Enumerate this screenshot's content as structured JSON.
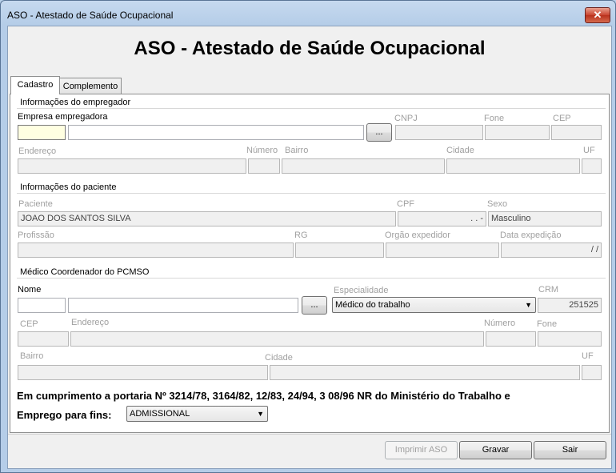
{
  "window": {
    "title": "ASO - Atestado de Saúde Ocupacional",
    "close_symbol": "✕"
  },
  "heading": "ASO - Atestado de Saúde Ocupacional",
  "tabs": [
    {
      "label": "Cadastro"
    },
    {
      "label": "Complemento"
    }
  ],
  "employer": {
    "section_title": "Informações do empregador",
    "company_label": "Empresa empregadora",
    "cnpj_label": "CNPJ",
    "fone_label": "Fone",
    "cep_label": "CEP",
    "address_label": "Endereço",
    "number_label": "Número",
    "district_label": "Bairro",
    "city_label": "Cidade",
    "uf_label": "UF",
    "browse_label": "..."
  },
  "patient": {
    "section_title": "Informações do paciente",
    "name_label": "Paciente",
    "name_value": "JOAO DOS SANTOS SILVA",
    "cpf_label": "CPF",
    "cpf_value": ". . -",
    "sex_label": "Sexo",
    "sex_value": "Masculino",
    "profession_label": "Profissão",
    "rg_label": "RG",
    "issuer_label": "Orgão expedidor",
    "issue_date_label": "Data expedição",
    "issue_date_value": "/ /"
  },
  "doctor": {
    "section_title": "Médico Coordenador do PCMSO",
    "name_label": "Nome",
    "browse_label": "...",
    "specialty_label": "Especialidade",
    "specialty_value": "Médico do trabalho",
    "crm_label": "CRM",
    "crm_value": "251525",
    "cep_label": "CEP",
    "address_label": "Endereço",
    "number_label": "Número",
    "fone_label": "Fone",
    "district_label": "Bairro",
    "city_label": "Cidade",
    "uf_label": "UF"
  },
  "compliance_text": "Em cumprimento a portaria Nº 3214/78, 3164/82, 12/83, 24/94, 3 08/96 NR do Ministério do Trabalho e",
  "purpose": {
    "label": "Emprego para fins:",
    "value": "ADMISSIONAL"
  },
  "buttons": {
    "print": "Imprimir ASO",
    "save": "Gravar",
    "exit": "Sair"
  }
}
